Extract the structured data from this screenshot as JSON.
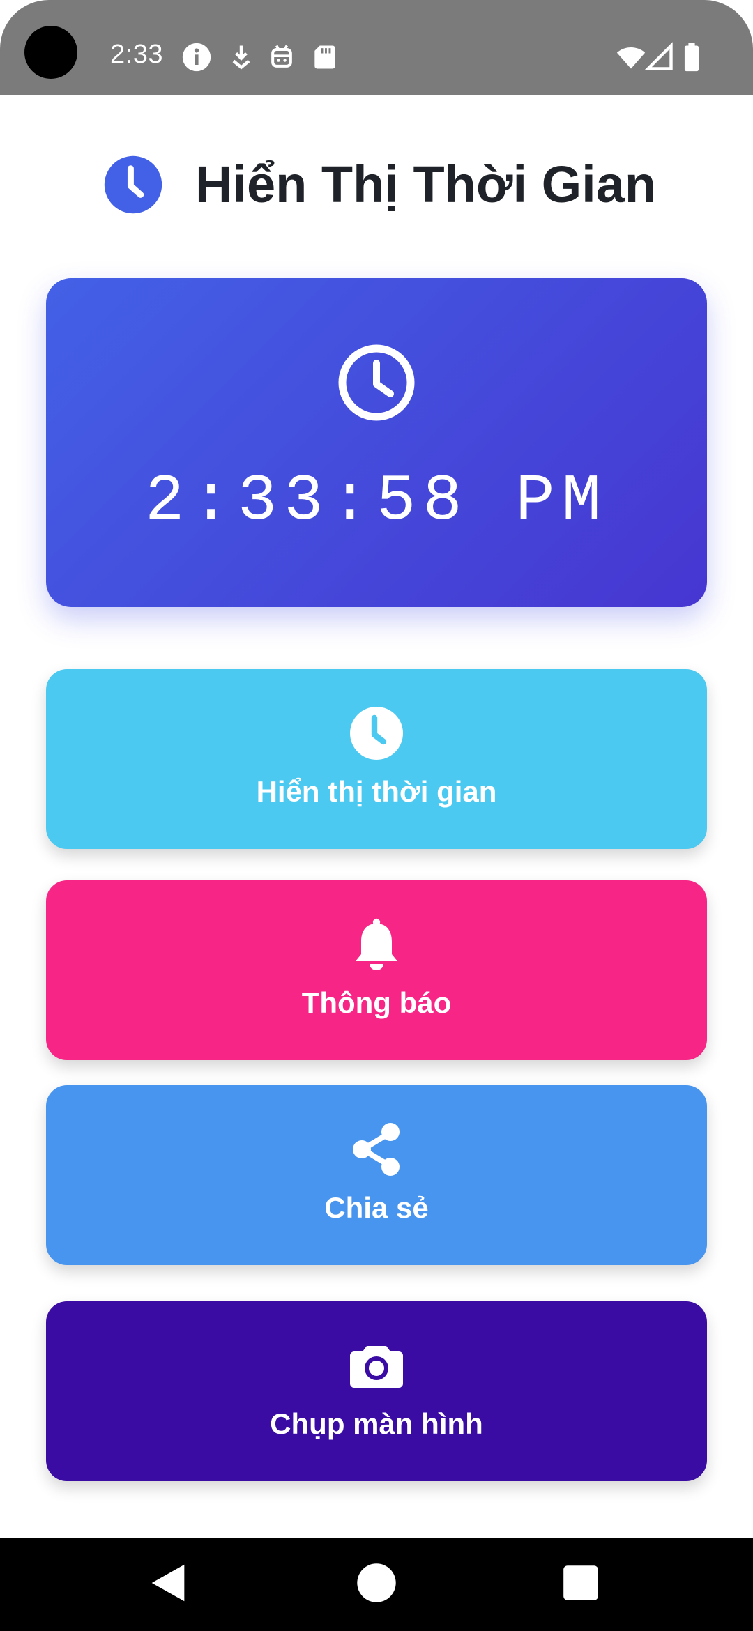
{
  "status_bar": {
    "time": "2:33",
    "icons": [
      "info-icon",
      "download-icon",
      "android-icon",
      "sd-card-icon",
      "wifi-icon",
      "signal-icon",
      "battery-icon"
    ]
  },
  "header": {
    "title": "Hiển Thị Thời Gian",
    "icon": "clock-icon",
    "icon_color": "#4361e6"
  },
  "clock_card": {
    "time": "2:33:58 PM",
    "icon": "clock-icon",
    "gradient_start": "#4361e6",
    "gradient_end": "#4636d1"
  },
  "actions": [
    {
      "label": "Hiển thị thời gian",
      "icon": "clock-icon",
      "color": "#4cc9f0"
    },
    {
      "label": "Thông báo",
      "icon": "bell-icon",
      "color": "#f72585"
    },
    {
      "label": "Chia sẻ",
      "icon": "share-icon",
      "color": "#4895ef"
    },
    {
      "label": "Chụp màn hình",
      "icon": "camera-icon",
      "color": "#3a0ca3"
    }
  ],
  "nav_bar": {
    "buttons": [
      "back-icon",
      "home-icon",
      "recents-icon"
    ]
  }
}
